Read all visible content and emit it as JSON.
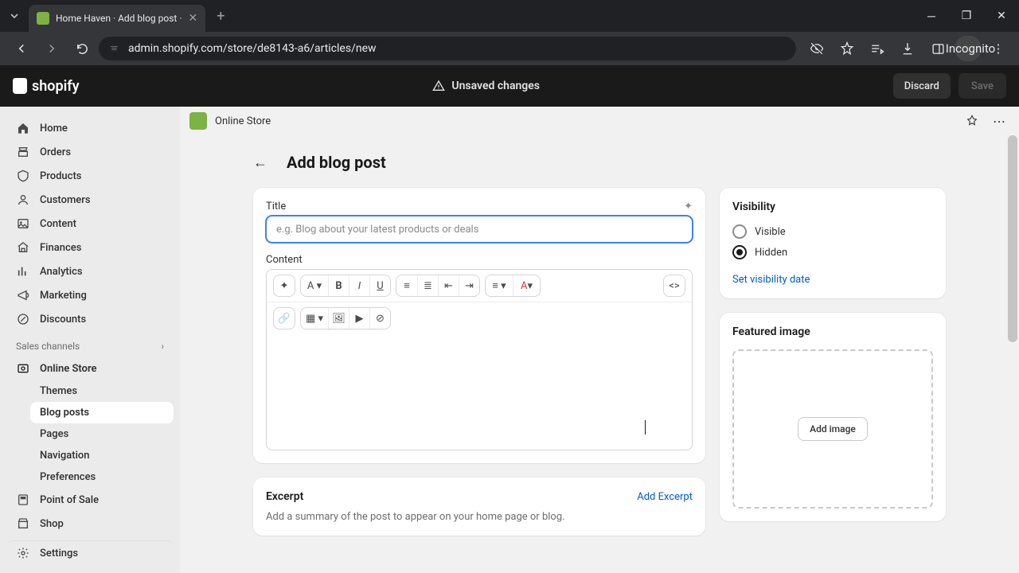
{
  "browser": {
    "tab_title": "Home Haven · Add blog post · ",
    "url": "admin.shopify.com/store/de8143-a6/articles/new",
    "incognito_label": "Incognito"
  },
  "app_bar": {
    "brand": "shopify",
    "unsaved_label": "Unsaved changes",
    "discard_label": "Discard",
    "save_label": "Save"
  },
  "sidebar": {
    "items": [
      {
        "label": "Home"
      },
      {
        "label": "Orders"
      },
      {
        "label": "Products"
      },
      {
        "label": "Customers"
      },
      {
        "label": "Content"
      },
      {
        "label": "Finances"
      },
      {
        "label": "Analytics"
      },
      {
        "label": "Marketing"
      },
      {
        "label": "Discounts"
      }
    ],
    "section_label": "Sales channels",
    "online_store": "Online Store",
    "subitems": [
      {
        "label": "Themes"
      },
      {
        "label": "Blog posts"
      },
      {
        "label": "Pages"
      },
      {
        "label": "Navigation"
      },
      {
        "label": "Preferences"
      }
    ],
    "pos": "Point of Sale",
    "shop": "Shop",
    "settings": "Settings"
  },
  "breadcrumb": {
    "label": "Online Store"
  },
  "page": {
    "title": "Add blog post"
  },
  "form": {
    "title_label": "Title",
    "title_placeholder": "e.g. Blog about your latest products or deals",
    "title_value": "",
    "content_label": "Content",
    "excerpt_title": "Excerpt",
    "excerpt_link": "Add Excerpt",
    "excerpt_desc": "Add a summary of the post to appear on your home page or blog."
  },
  "visibility": {
    "title": "Visibility",
    "visible_label": "Visible",
    "hidden_label": "Hidden",
    "selected": "hidden",
    "link": "Set visibility date"
  },
  "featured": {
    "title": "Featured image",
    "button": "Add image"
  }
}
